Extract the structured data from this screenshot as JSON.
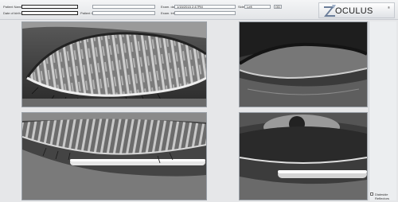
{
  "header": {
    "patient_name_label": "Patient Name:",
    "patient_name_value": "",
    "dob_label": "Date of birth:",
    "dob_value": "",
    "patient_id_label": "Patient ID:",
    "patient_id_value": "",
    "exam_date_label": "Exam. date:",
    "exam_date_value": "1/15/2015 2:47PM",
    "side_label": "Side:",
    "side_value": "Left",
    "side_button": "OD",
    "exam_info_label": "Exam. Info:",
    "exam_info_value": ""
  },
  "logo": {
    "text": "OCULUS",
    "mark": "Z",
    "registered": "®"
  },
  "sidebar": {
    "checkbox_label": "Dialeside Reflectors"
  }
}
